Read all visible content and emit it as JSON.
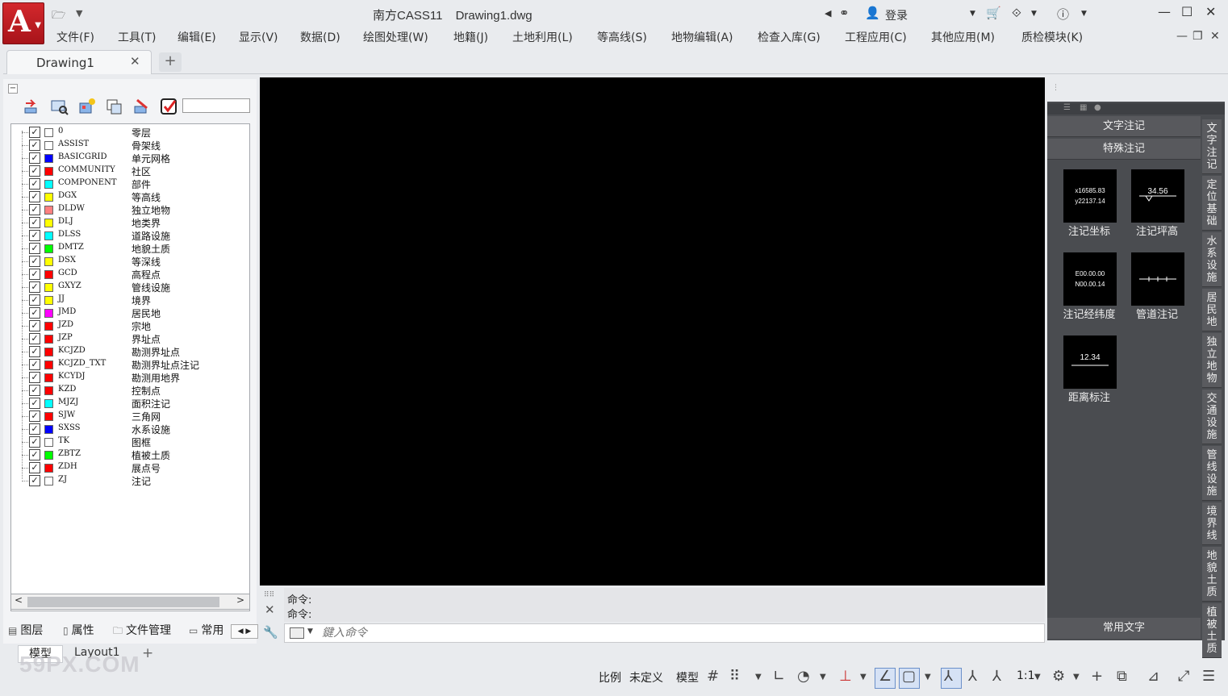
{
  "app": {
    "title": "南方CASS11",
    "document": "Drawing1.dwg",
    "logo_letter": "A",
    "login_label": "登录"
  },
  "menu": [
    "文件(F)",
    "工具(T)",
    "编辑(E)",
    "显示(V)",
    "数据(D)",
    "绘图处理(W)",
    "地籍(J)",
    "土地利用(L)",
    "等高线(S)",
    "地物编辑(A)",
    "检查入库(G)",
    "工程应用(C)",
    "其他应用(M)",
    "质检模块(K)"
  ],
  "tabs": {
    "doc_tab": "Drawing1",
    "close": "✕",
    "add": "+"
  },
  "layers": [
    {
      "name": "0",
      "desc": "零层",
      "color": "#ffffff"
    },
    {
      "name": "ASSIST",
      "desc": "骨架线",
      "color": "#ffffff"
    },
    {
      "name": "BASICGRID",
      "desc": "单元网格",
      "color": "#0000ff"
    },
    {
      "name": "COMMUNITY",
      "desc": "社区",
      "color": "#ff0000"
    },
    {
      "name": "COMPONENT",
      "desc": "部件",
      "color": "#00ffff"
    },
    {
      "name": "DGX",
      "desc": "等高线",
      "color": "#ffff00"
    },
    {
      "name": "DLDW",
      "desc": "独立地物",
      "color": "#ff8080"
    },
    {
      "name": "DLJ",
      "desc": "地类界",
      "color": "#ffff00"
    },
    {
      "name": "DLSS",
      "desc": "道路设施",
      "color": "#00ffff"
    },
    {
      "name": "DMTZ",
      "desc": "地貌土质",
      "color": "#00ff00"
    },
    {
      "name": "DSX",
      "desc": "等深线",
      "color": "#ffff00"
    },
    {
      "name": "GCD",
      "desc": "高程点",
      "color": "#ff0000"
    },
    {
      "name": "GXYZ",
      "desc": "管线设施",
      "color": "#ffff00"
    },
    {
      "name": "JJ",
      "desc": "境界",
      "color": "#ffff00"
    },
    {
      "name": "JMD",
      "desc": "居民地",
      "color": "#ff00ff"
    },
    {
      "name": "JZD",
      "desc": "宗地",
      "color": "#ff0000"
    },
    {
      "name": "JZP",
      "desc": "界址点",
      "color": "#ff0000"
    },
    {
      "name": "KCJZD",
      "desc": "勘测界址点",
      "color": "#ff0000"
    },
    {
      "name": "KCJZD_TXT",
      "desc": "勘测界址点注记",
      "color": "#ff0000"
    },
    {
      "name": "KCYDJ",
      "desc": "勘测用地界",
      "color": "#ff0000"
    },
    {
      "name": "KZD",
      "desc": "控制点",
      "color": "#ff0000"
    },
    {
      "name": "MJZJ",
      "desc": "面积注记",
      "color": "#00ffff"
    },
    {
      "name": "SJW",
      "desc": "三角网",
      "color": "#ff0000"
    },
    {
      "name": "SXSS",
      "desc": "水系设施",
      "color": "#0000ff"
    },
    {
      "name": "TK",
      "desc": "图框",
      "color": "#ffffff"
    },
    {
      "name": "ZBTZ",
      "desc": "植被土质",
      "color": "#00ff00"
    },
    {
      "name": "ZDH",
      "desc": "展点号",
      "color": "#ff0000"
    },
    {
      "name": "ZJ",
      "desc": "注记",
      "color": "#ffffff"
    }
  ],
  "panel_tabs": [
    "图层",
    "属性",
    "文件管理",
    "常用"
  ],
  "command": {
    "history": [
      "命令:",
      "命令:"
    ],
    "placeholder": "鍵入命令"
  },
  "right_panel": {
    "sections": [
      "文字注记",
      "特殊注记"
    ],
    "tiles": [
      {
        "label": "注记坐标",
        "lines": [
          "x16585.83",
          "y22137.14"
        ]
      },
      {
        "label": "注记坪高",
        "lines": [
          "34.56"
        ]
      },
      {
        "label": "注记经纬度",
        "lines": [
          "E00.00.00",
          "N00.00.14"
        ]
      },
      {
        "label": "管道注记",
        "lines": []
      },
      {
        "label": "距离标注",
        "lines": [
          "12.34"
        ]
      }
    ],
    "vertical_tabs": [
      "文字注记",
      "定位基础",
      "水系设施",
      "居民地",
      "独立地物",
      "交通设施",
      "管线设施",
      "境界线",
      "地貌土质",
      "植被土质"
    ],
    "bottom_label": "常用文字"
  },
  "layout_tabs": {
    "model": "模型",
    "layout": "Layout1",
    "add": "+"
  },
  "watermark": "59PX.COM",
  "status": {
    "scale_label": "比例",
    "scale_value": "未定义",
    "model": "模型",
    "ratio": "1:1"
  }
}
